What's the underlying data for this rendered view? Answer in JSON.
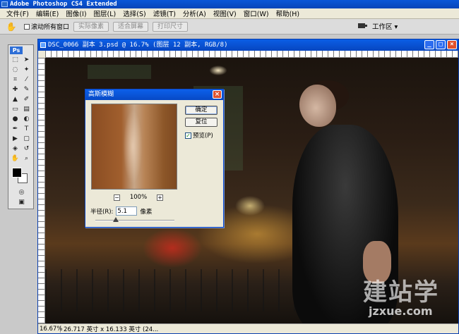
{
  "app": {
    "title": "Adobe Photoshop CS4 Extended"
  },
  "menu": [
    "文件(F)",
    "编辑(E)",
    "图像(I)",
    "图层(L)",
    "选择(S)",
    "滤镜(T)",
    "分析(A)",
    "视图(V)",
    "窗口(W)",
    "帮助(H)"
  ],
  "options": {
    "scroll_all": "滚动所有窗口",
    "actual_pixels": "实际像素",
    "fit_screen": "适合屏幕",
    "print_size": "打印尺寸",
    "workspace": "工作区 ▾"
  },
  "toolbox": {
    "badge": "Ps"
  },
  "document": {
    "title": "DSC_0066 副本 3.psd @ 16.7% (图层 12 副本, RGB/8)",
    "zoom": "16.67%",
    "info": "26.717 英寸 x 16.133 英寸 (24..."
  },
  "dialog": {
    "title": "高斯模糊",
    "ok": "确定",
    "reset": "复位",
    "preview": "预览(P)",
    "zoom_minus": "−",
    "zoom_value": "100%",
    "zoom_plus": "+",
    "radius_label": "半径(R):",
    "radius_value": "5.1",
    "radius_unit": "像素",
    "radius_slider_fraction": 0.26
  },
  "watermark": {
    "main": "建站学",
    "sub": "jzxue.com"
  }
}
